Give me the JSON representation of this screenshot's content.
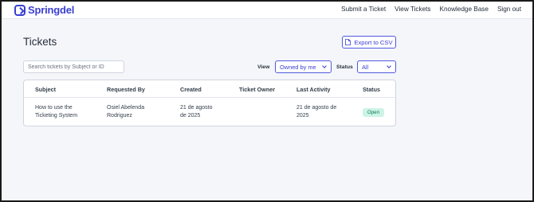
{
  "app": {
    "brand": "Springdel"
  },
  "nav": {
    "items": [
      "Submit a Ticket",
      "View Tickets",
      "Knowledge Base",
      "Sign out"
    ]
  },
  "page": {
    "title": "Tickets",
    "export_label": "Export to CSV"
  },
  "filters": {
    "search_placeholder": "Search tickets by Subject or ID",
    "view_label": "View",
    "view_value": "Owned by me",
    "status_label": "Status",
    "status_value": "All"
  },
  "table": {
    "columns": [
      "Subject",
      "Requested By",
      "Created",
      "Ticket Owner",
      "Last Activity",
      "Status"
    ],
    "rows": [
      {
        "subject_line1": "How to use the",
        "subject_line2": "Ticketing System",
        "requested_line1": "Osiel Abelenda",
        "requested_line2": "Rodriguez",
        "created_line1": "21 de agosto",
        "created_line2": "de 2025",
        "owner": "",
        "activity_line1": "21 de agosto de",
        "activity_line2": "2025",
        "status": "Open"
      }
    ]
  },
  "colors": {
    "accent": "#3a3fd1",
    "status_open_bg": "#cdf3e6",
    "status_open_text": "#0e7a55"
  }
}
